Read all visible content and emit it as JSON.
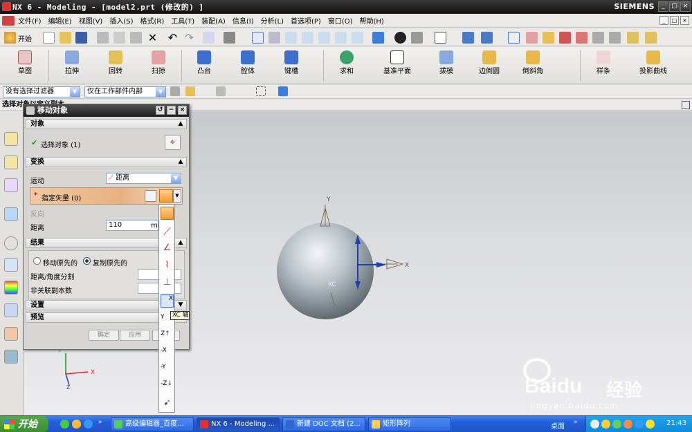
{
  "window": {
    "title": "NX 6 - Modeling - [model2.prt  (修改的) ]",
    "brand": "SIEMENS"
  },
  "menu": [
    "文件(F)",
    "编辑(E)",
    "视图(V)",
    "插入(S)",
    "格式(R)",
    "工具(T)",
    "装配(A)",
    "信息(I)",
    "分析(L)",
    "首选项(P)",
    "窗口(O)",
    "帮助(H)"
  ],
  "toolbar": {
    "start_label": "开始"
  },
  "feature_toolbar": [
    "草图",
    "拉伸",
    "回转",
    "扫掠",
    "凸台",
    "腔体",
    "键槽",
    "求和",
    "基准平面",
    "拔模",
    "边倒圆",
    "倒斜角",
    "样条",
    "投影曲线"
  ],
  "filter": {
    "type_filter": "没有选择过滤器",
    "scope": "仅在工作部件内部"
  },
  "cue_line": "选择对象以定义副本",
  "dialog": {
    "title": "移动对象",
    "sections": {
      "object": "对象",
      "transform": "变换",
      "result": "结果",
      "settings": "设置",
      "preview": "预览"
    },
    "select_object": "选择对象 (1)",
    "motion_label": "运动",
    "motion_value": "距离",
    "specify_vector": "指定矢量 (0)",
    "reverse_label": "反向",
    "distance_label": "距离",
    "distance_value": "110",
    "distance_unit": "mm",
    "move_original": "移动原先的",
    "copy_original": "复制原先的",
    "dist_angle_divide": "距离/角度分割",
    "nonassoc_copies": "非关联副本数",
    "buttons": {
      "ok": "确定",
      "apply": "应用",
      "cancel": "取消"
    }
  },
  "vector_tooltip": "XC 轴",
  "vector_list_labels": [
    "X",
    "Y",
    "Z",
    "-X",
    "-Y",
    "-Z"
  ],
  "graphics": {
    "axis_x": "X",
    "axis_y": "Y",
    "axis_xc": "XC",
    "triad_x": "X",
    "triad_y": "Y",
    "triad_z": "Z"
  },
  "taskbar": {
    "start": "开始",
    "tasks": [
      "高级编辑器_百度...",
      "NX 6 - Modeling ...",
      "新建 DOC 文档 (2...",
      "矩形阵列"
    ],
    "desktop": "桌面",
    "clock": "21:43"
  },
  "watermark": {
    "logo": "Baidu",
    "jingyan": "经验",
    "url": "jingyan.baidu.com"
  }
}
